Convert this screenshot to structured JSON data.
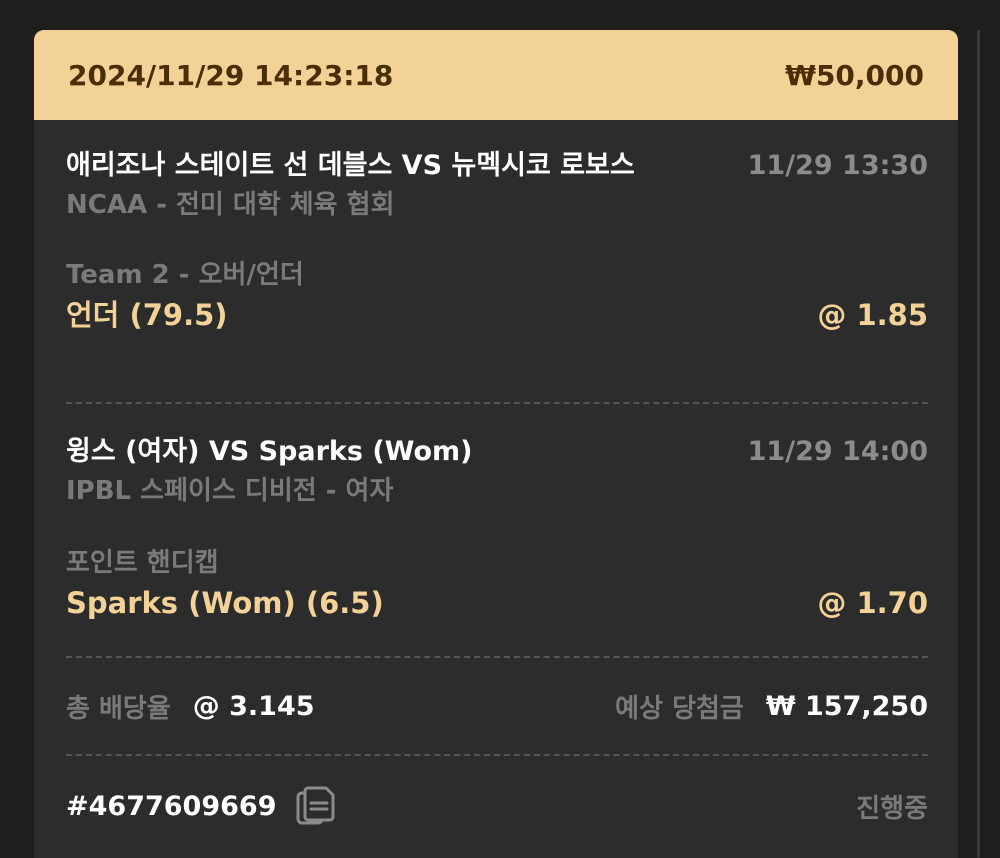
{
  "header": {
    "datetime": "2024/11/29 14:23:18",
    "stake": "₩50,000"
  },
  "matches": [
    {
      "teams": "애리조나 스테이트 선 데블스 VS 뉴멕시코 로보스",
      "time": "11/29 13:30",
      "league": "NCAA - 전미 대학 체육 협회",
      "market": "Team 2 - 오버/언더",
      "pick": "언더 (79.5)",
      "odds": "@ 1.85"
    },
    {
      "teams": "윙스 (여자) VS Sparks (Wom)",
      "time": "11/29 14:00",
      "league": "IPBL 스페이스 디비전 - 여자",
      "market": "포인트 핸디캡",
      "pick": "Sparks (Wom) (6.5)",
      "odds": "@ 1.70"
    }
  ],
  "summary": {
    "total_odds_label": "총 배당율",
    "total_odds_value": "@ 3.145",
    "expected_win_label": "예상 당첨금",
    "expected_win_value": "₩ 157,250"
  },
  "footer": {
    "bet_id": "#4677609669",
    "copy_icon": "copy-icon",
    "status": "진행중"
  },
  "colors": {
    "header_bg": "#f2d296",
    "header_text": "#4a2e05",
    "accent": "#f2d296",
    "card_bg": "#2c2c2c",
    "page_bg": "#1e1e1e"
  }
}
